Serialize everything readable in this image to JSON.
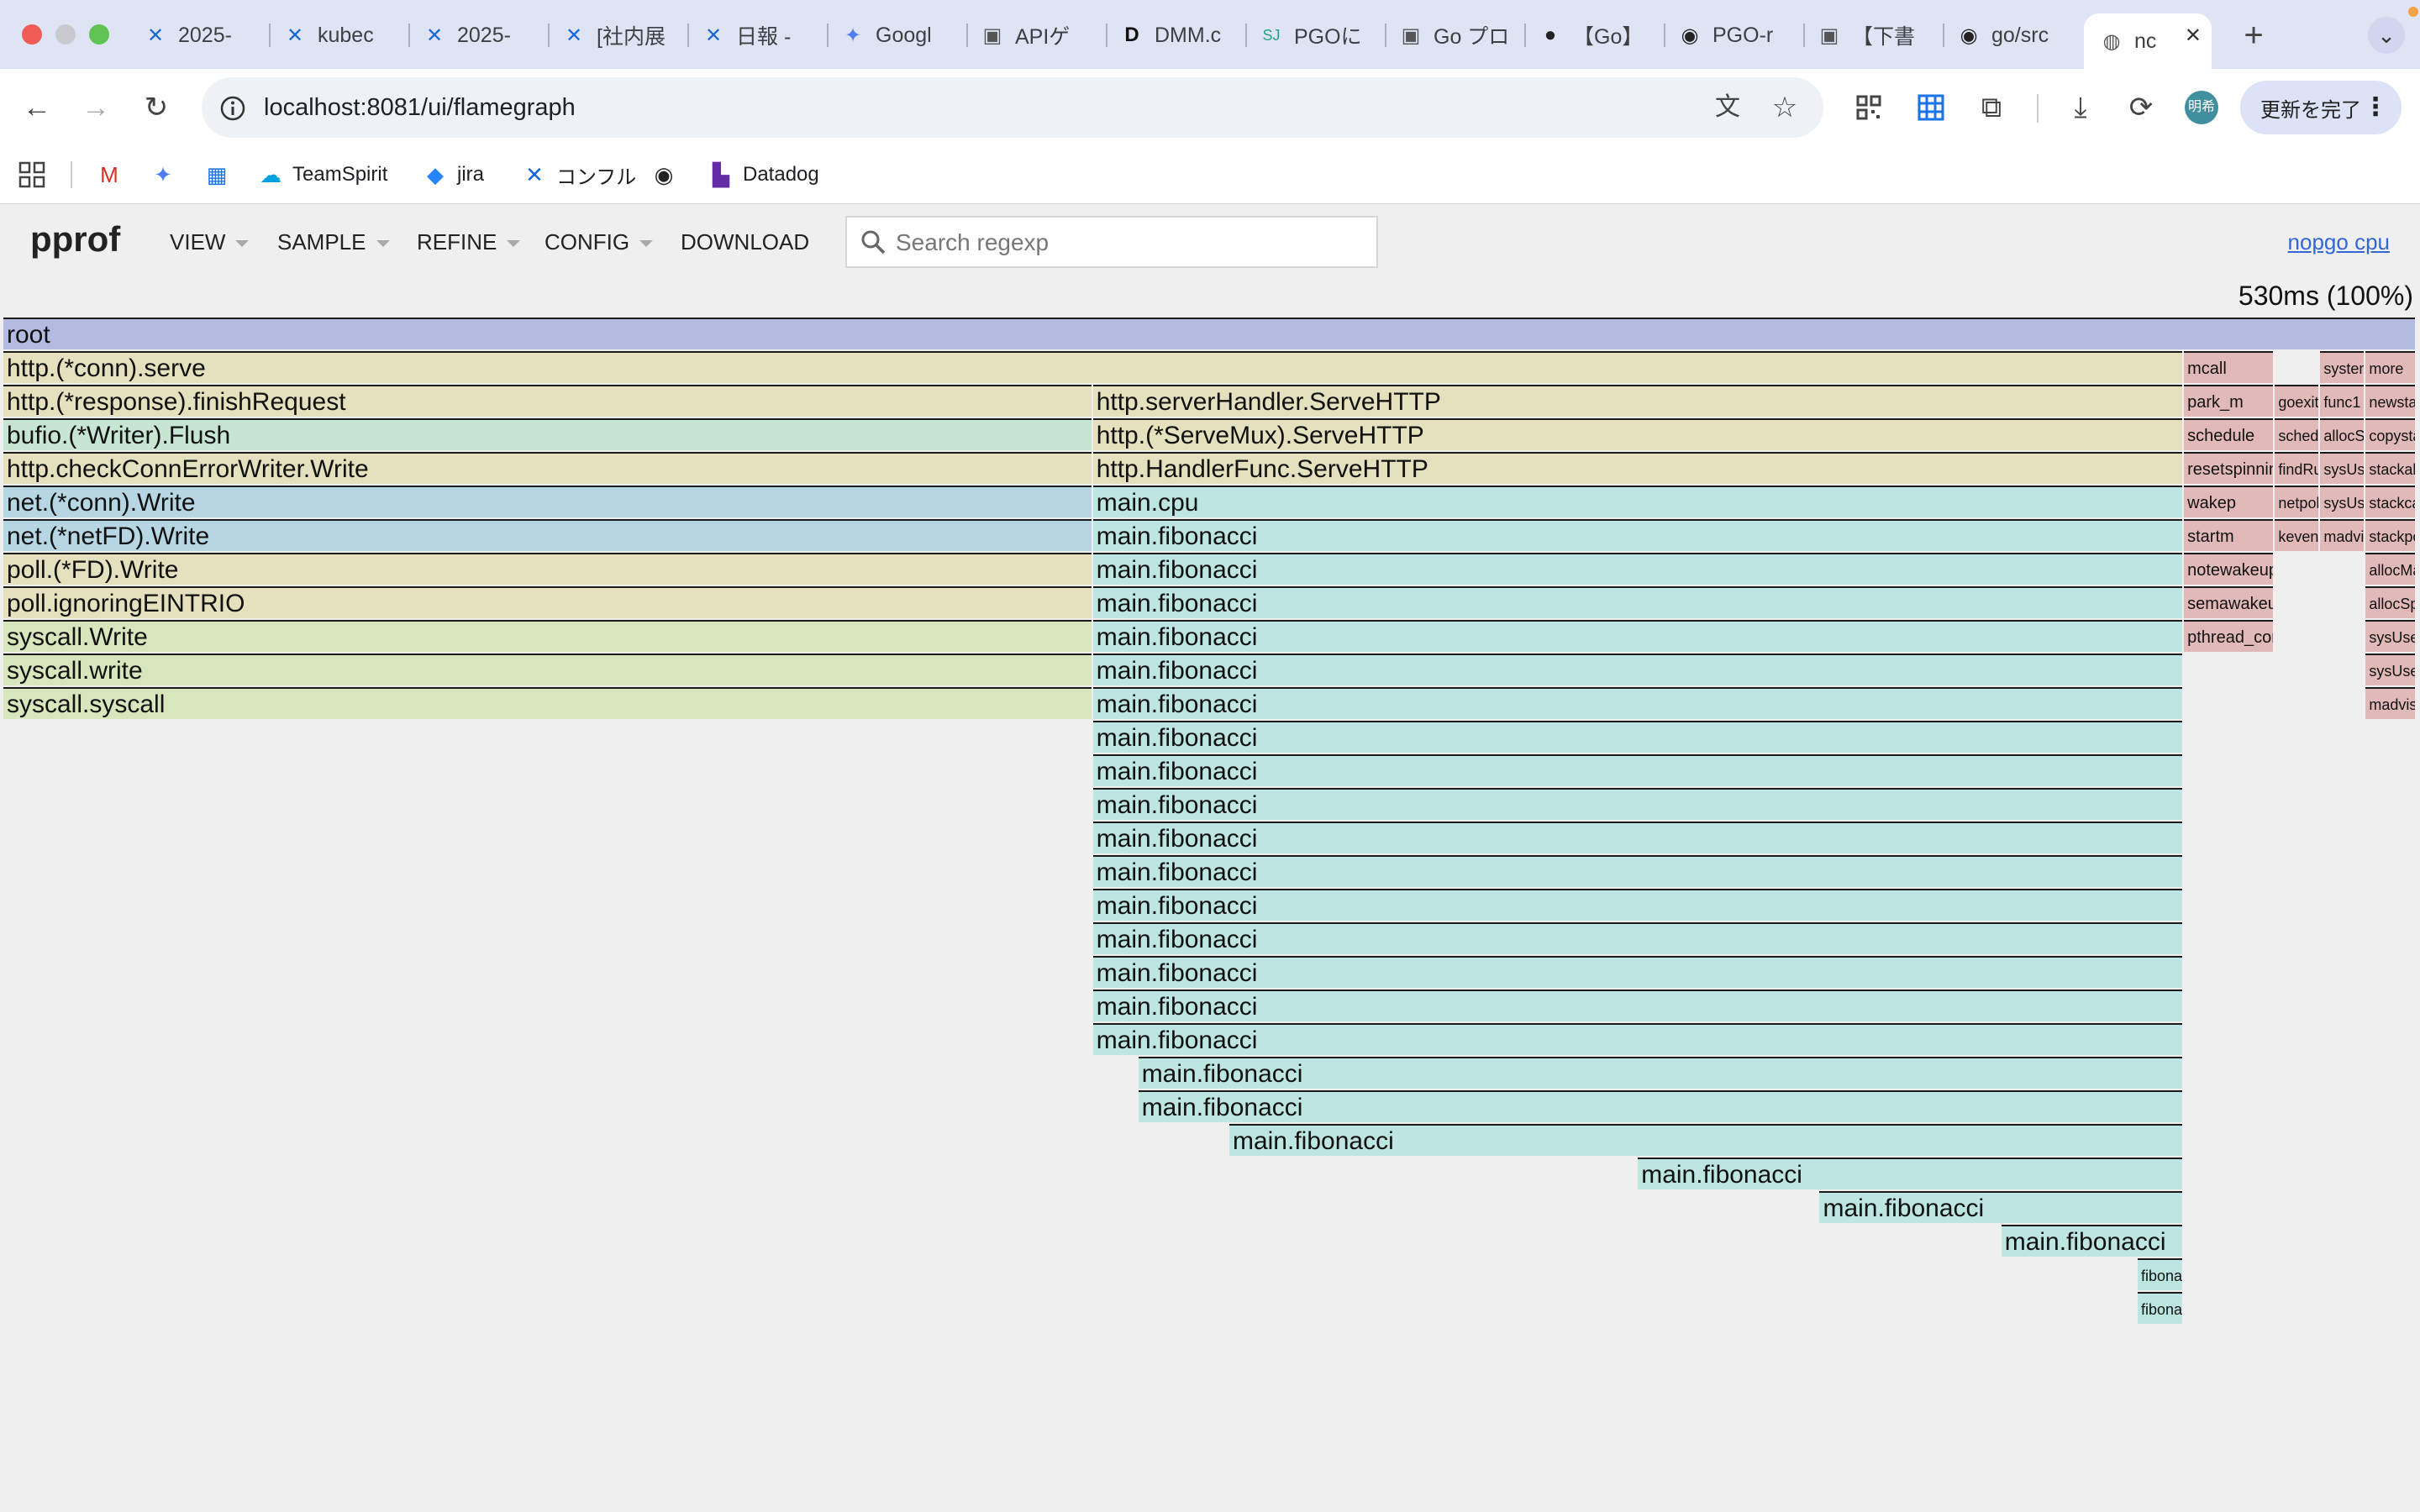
{
  "browser": {
    "tabs": [
      {
        "label": "2025-",
        "icon": "confluence-icon"
      },
      {
        "label": "kubec",
        "icon": "confluence-icon"
      },
      {
        "label": "2025-",
        "icon": "confluence-icon"
      },
      {
        "label": "[社内展",
        "icon": "confluence-icon"
      },
      {
        "label": "日報 -",
        "icon": "confluence-icon"
      },
      {
        "label": "Googl",
        "icon": "gemini-icon"
      },
      {
        "label": "APIゲ",
        "icon": "app-icon"
      },
      {
        "label": "DMM.c",
        "icon": "dmm-icon"
      },
      {
        "label": "PGOに",
        "icon": "sj-icon"
      },
      {
        "label": "Go プロ",
        "icon": "app-icon"
      },
      {
        "label": "【Go】",
        "icon": "code-icon"
      },
      {
        "label": "PGO-r",
        "icon": "github-icon"
      },
      {
        "label": "【下書",
        "icon": "app-icon"
      },
      {
        "label": "go/src",
        "icon": "github-icon"
      },
      {
        "label": "nc",
        "icon": "globe-icon"
      }
    ],
    "url": "localhost:8081/ui/flamegraph",
    "update_button": "更新を完了",
    "avatar_text": "明希",
    "bookmarks": [
      {
        "label": "",
        "icon": "gmail-icon"
      },
      {
        "label": "",
        "icon": "gemini-icon"
      },
      {
        "label": "",
        "icon": "calendar-icon"
      },
      {
        "label": "TeamSpirit",
        "icon": "salesforce-icon"
      },
      {
        "label": "jira",
        "icon": "jira-icon"
      },
      {
        "label": "コンフル",
        "icon": "confluence-icon"
      },
      {
        "label": "",
        "icon": "github-icon"
      },
      {
        "label": "Datadog",
        "icon": "datadog-icon"
      }
    ]
  },
  "pprof": {
    "logo": "pprof",
    "menu": [
      "VIEW",
      "SAMPLE",
      "REFINE",
      "CONFIG",
      "DOWNLOAD"
    ],
    "search_placeholder": "Search regexp",
    "profile_link": "nopgo cpu",
    "total": "530ms (100%)"
  },
  "flamegraph": {
    "colors": {
      "root": "#b3bce0",
      "http": "#e5e0bd",
      "bufio": "#c6e6d3",
      "net": "#b7d6e3",
      "syscall": "#d8e6bd",
      "main": "#bde5e2",
      "runtime": "#e2b9b9"
    },
    "frames": [
      {
        "name": "root",
        "depth": 0,
        "start": 0,
        "end": 1,
        "group": "root"
      },
      {
        "name": "http.(*conn).serve",
        "depth": 1,
        "start": 0,
        "end": 0.9036,
        "group": "http"
      },
      {
        "name": "http.(*response).finishRequest",
        "depth": 2,
        "start": 0,
        "end": 0.4515,
        "group": "http"
      },
      {
        "name": "bufio.(*Writer).Flush",
        "depth": 3,
        "start": 0,
        "end": 0.4515,
        "group": "bufio"
      },
      {
        "name": "http.checkConnErrorWriter.Write",
        "depth": 4,
        "start": 0,
        "end": 0.4515,
        "group": "http"
      },
      {
        "name": "net.(*conn).Write",
        "depth": 5,
        "start": 0,
        "end": 0.4515,
        "group": "net"
      },
      {
        "name": "net.(*netFD).Write",
        "depth": 6,
        "start": 0,
        "end": 0.4515,
        "group": "net"
      },
      {
        "name": "poll.(*FD).Write",
        "depth": 7,
        "start": 0,
        "end": 0.4515,
        "group": "http"
      },
      {
        "name": "poll.ignoringEINTRIO",
        "depth": 8,
        "start": 0,
        "end": 0.4515,
        "group": "http"
      },
      {
        "name": "syscall.Write",
        "depth": 9,
        "start": 0,
        "end": 0.4515,
        "group": "syscall"
      },
      {
        "name": "syscall.write",
        "depth": 10,
        "start": 0,
        "end": 0.4515,
        "group": "syscall"
      },
      {
        "name": "syscall.syscall",
        "depth": 11,
        "start": 0,
        "end": 0.4515,
        "group": "syscall"
      },
      {
        "name": "http.serverHandler.ServeHTTP",
        "depth": 2,
        "start": 0.4515,
        "end": 0.9036,
        "group": "http"
      },
      {
        "name": "http.(*ServeMux).ServeHTTP",
        "depth": 3,
        "start": 0.4515,
        "end": 0.9036,
        "group": "http"
      },
      {
        "name": "http.HandlerFunc.ServeHTTP",
        "depth": 4,
        "start": 0.4515,
        "end": 0.9036,
        "group": "http"
      },
      {
        "name": "main.cpu",
        "depth": 5,
        "start": 0.4515,
        "end": 0.9036,
        "group": "main"
      },
      {
        "name": "main.fibonacci",
        "depth": 6,
        "start": 0.4515,
        "end": 0.9036,
        "group": "main"
      },
      {
        "name": "main.fibonacci",
        "depth": 7,
        "start": 0.4515,
        "end": 0.9036,
        "group": "main"
      },
      {
        "name": "main.fibonacci",
        "depth": 8,
        "start": 0.4515,
        "end": 0.9036,
        "group": "main"
      },
      {
        "name": "main.fibonacci",
        "depth": 9,
        "start": 0.4515,
        "end": 0.9036,
        "group": "main"
      },
      {
        "name": "main.fibonacci",
        "depth": 10,
        "start": 0.4515,
        "end": 0.9036,
        "group": "main"
      },
      {
        "name": "main.fibonacci",
        "depth": 11,
        "start": 0.4515,
        "end": 0.9036,
        "group": "main"
      },
      {
        "name": "main.fibonacci",
        "depth": 12,
        "start": 0.4515,
        "end": 0.9036,
        "group": "main"
      },
      {
        "name": "main.fibonacci",
        "depth": 13,
        "start": 0.4515,
        "end": 0.9036,
        "group": "main"
      },
      {
        "name": "main.fibonacci",
        "depth": 14,
        "start": 0.4515,
        "end": 0.9036,
        "group": "main"
      },
      {
        "name": "main.fibonacci",
        "depth": 15,
        "start": 0.4515,
        "end": 0.9036,
        "group": "main"
      },
      {
        "name": "main.fibonacci",
        "depth": 16,
        "start": 0.4515,
        "end": 0.9036,
        "group": "main"
      },
      {
        "name": "main.fibonacci",
        "depth": 17,
        "start": 0.4515,
        "end": 0.9036,
        "group": "main"
      },
      {
        "name": "main.fibonacci",
        "depth": 18,
        "start": 0.4515,
        "end": 0.9036,
        "group": "main"
      },
      {
        "name": "main.fibonacci",
        "depth": 19,
        "start": 0.4515,
        "end": 0.9036,
        "group": "main"
      },
      {
        "name": "main.fibonacci",
        "depth": 20,
        "start": 0.4515,
        "end": 0.9036,
        "group": "main"
      },
      {
        "name": "main.fibonacci",
        "depth": 21,
        "start": 0.4515,
        "end": 0.9036,
        "group": "main"
      },
      {
        "name": "main.fibonacci",
        "depth": 22,
        "start": 0.4703,
        "end": 0.9036,
        "group": "main"
      },
      {
        "name": "main.fibonacci",
        "depth": 23,
        "start": 0.4703,
        "end": 0.9036,
        "group": "main"
      },
      {
        "name": "main.fibonacci",
        "depth": 24,
        "start": 0.508,
        "end": 0.9036,
        "group": "main"
      },
      {
        "name": "main.fibonacci",
        "depth": 25,
        "start": 0.6773,
        "end": 0.9036,
        "group": "main"
      },
      {
        "name": "main.fibonacci",
        "depth": 26,
        "start": 0.7526,
        "end": 0.9036,
        "group": "main"
      },
      {
        "name": "main.fibonacci",
        "depth": 27,
        "start": 0.8279,
        "end": 0.9036,
        "group": "main"
      },
      {
        "name": "fibonacci",
        "depth": 28,
        "start": 0.8844,
        "end": 0.9036,
        "group": "main"
      },
      {
        "name": "fibonacci",
        "depth": 29,
        "start": 0.8844,
        "end": 0.9036,
        "group": "main"
      },
      {
        "name": "mcall",
        "depth": 1,
        "start": 0.9036,
        "end": 0.9413,
        "group": "runtime"
      },
      {
        "name": "park_m",
        "depth": 2,
        "start": 0.9036,
        "end": 0.9413,
        "group": "runtime"
      },
      {
        "name": "schedule",
        "depth": 3,
        "start": 0.9036,
        "end": 0.9413,
        "group": "runtime"
      },
      {
        "name": "resetspinning",
        "depth": 4,
        "start": 0.9036,
        "end": 0.9413,
        "group": "runtime"
      },
      {
        "name": "wakep",
        "depth": 5,
        "start": 0.9036,
        "end": 0.9413,
        "group": "runtime"
      },
      {
        "name": "startm",
        "depth": 6,
        "start": 0.9036,
        "end": 0.9413,
        "group": "runtime"
      },
      {
        "name": "notewakeup",
        "depth": 7,
        "start": 0.9036,
        "end": 0.9413,
        "group": "runtime"
      },
      {
        "name": "semawakeup",
        "depth": 8,
        "start": 0.9036,
        "end": 0.9413,
        "group": "runtime"
      },
      {
        "name": "pthread_cond_signal",
        "depth": 9,
        "start": 0.9036,
        "end": 0.9413,
        "group": "runtime"
      },
      {
        "name": "goexit",
        "depth": 2,
        "start": 0.9413,
        "end": 0.9601,
        "group": "runtime"
      },
      {
        "name": "schedule",
        "depth": 3,
        "start": 0.9413,
        "end": 0.9601,
        "group": "runtime"
      },
      {
        "name": "findRunnable",
        "depth": 4,
        "start": 0.9413,
        "end": 0.9601,
        "group": "runtime"
      },
      {
        "name": "netpoll",
        "depth": 5,
        "start": 0.9413,
        "end": 0.9601,
        "group": "runtime"
      },
      {
        "name": "kevent",
        "depth": 6,
        "start": 0.9413,
        "end": 0.9601,
        "group": "runtime"
      },
      {
        "name": "systemstack",
        "depth": 1,
        "start": 0.9601,
        "end": 0.9789,
        "group": "runtime"
      },
      {
        "name": "func1",
        "depth": 2,
        "start": 0.9601,
        "end": 0.9789,
        "group": "runtime"
      },
      {
        "name": "allocSpan",
        "depth": 3,
        "start": 0.9601,
        "end": 0.9789,
        "group": "runtime"
      },
      {
        "name": "sysUsed",
        "depth": 4,
        "start": 0.9601,
        "end": 0.9789,
        "group": "runtime"
      },
      {
        "name": "sysUsedOS",
        "depth": 5,
        "start": 0.9601,
        "end": 0.9789,
        "group": "runtime"
      },
      {
        "name": "madvise",
        "depth": 6,
        "start": 0.9601,
        "end": 0.9789,
        "group": "runtime"
      },
      {
        "name": "more",
        "depth": 1,
        "start": 0.9789,
        "end": 1,
        "group": "runtime"
      },
      {
        "name": "newstack",
        "depth": 2,
        "start": 0.9789,
        "end": 1,
        "group": "runtime"
      },
      {
        "name": "copystack",
        "depth": 3,
        "start": 0.9789,
        "end": 1,
        "group": "runtime"
      },
      {
        "name": "stackalloc",
        "depth": 4,
        "start": 0.9789,
        "end": 1,
        "group": "runtime"
      },
      {
        "name": "stackcacherefill",
        "depth": 5,
        "start": 0.9789,
        "end": 1,
        "group": "runtime"
      },
      {
        "name": "stackpoolalloc",
        "depth": 6,
        "start": 0.9789,
        "end": 1,
        "group": "runtime"
      },
      {
        "name": "allocManual",
        "depth": 7,
        "start": 0.9789,
        "end": 1,
        "group": "runtime"
      },
      {
        "name": "allocSpan",
        "depth": 8,
        "start": 0.9789,
        "end": 1,
        "group": "runtime"
      },
      {
        "name": "sysUsed",
        "depth": 9,
        "start": 0.9789,
        "end": 1,
        "group": "runtime"
      },
      {
        "name": "sysUsedOS",
        "depth": 10,
        "start": 0.9789,
        "end": 1,
        "group": "runtime"
      },
      {
        "name": "madvise",
        "depth": 11,
        "start": 0.9789,
        "end": 1,
        "group": "runtime"
      }
    ]
  }
}
